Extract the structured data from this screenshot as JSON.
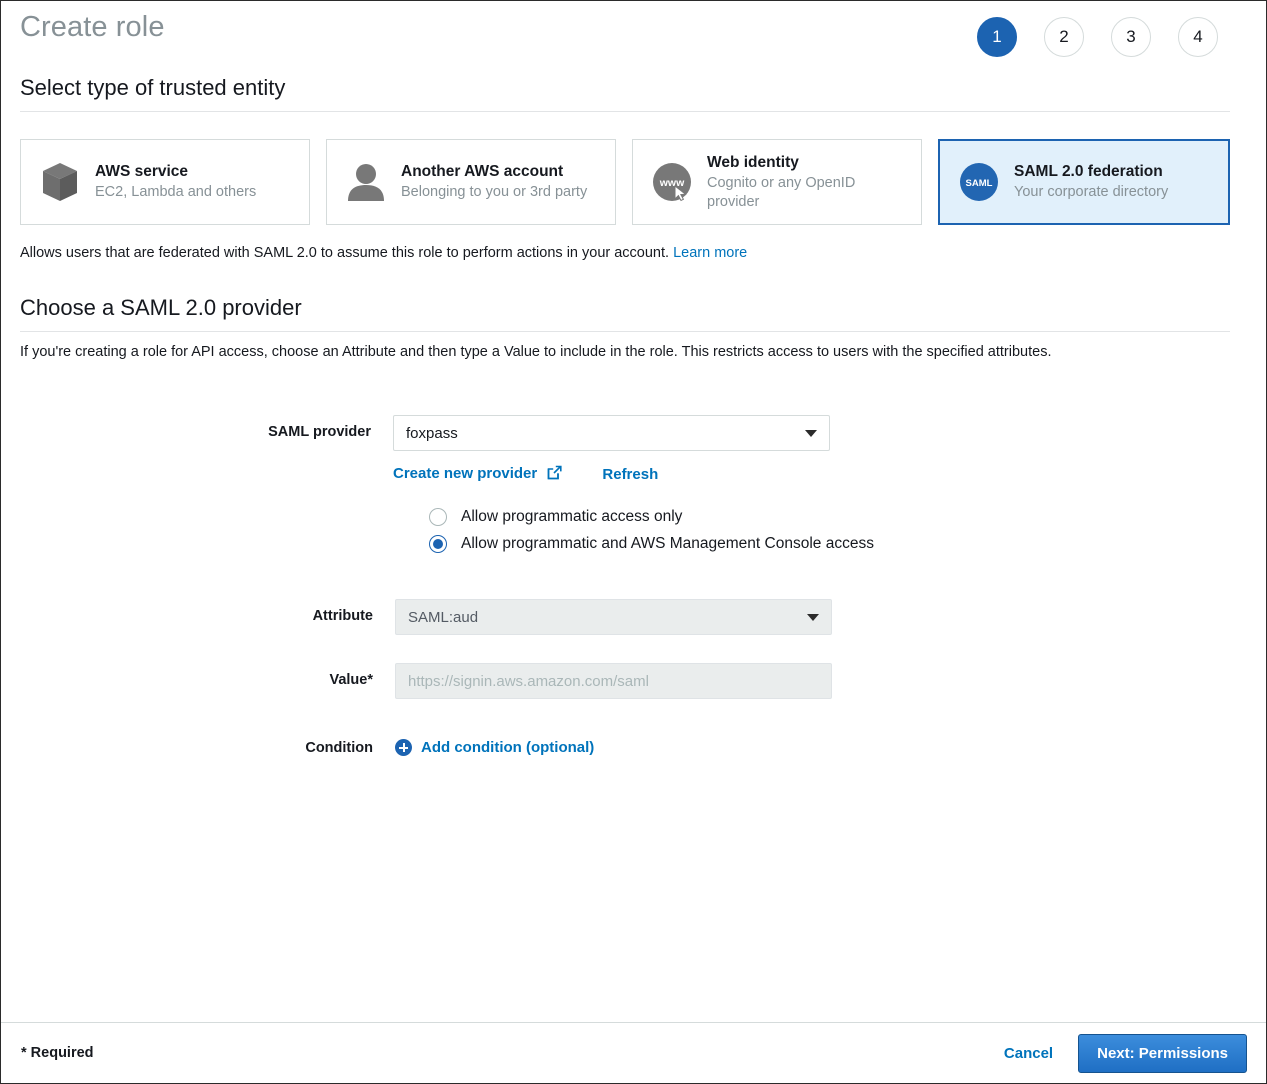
{
  "header": {
    "title": "Create role",
    "steps": [
      {
        "label": "1",
        "active": true
      },
      {
        "label": "2",
        "active": false
      },
      {
        "label": "3",
        "active": false
      },
      {
        "label": "4",
        "active": false
      }
    ]
  },
  "trusted_entity": {
    "heading": "Select type of trusted entity",
    "cards": [
      {
        "icon": "cube-icon",
        "title": "AWS service",
        "subtitle": "EC2, Lambda and others",
        "selected": false
      },
      {
        "icon": "user-icon",
        "title": "Another AWS account",
        "subtitle": "Belonging to you or 3rd party",
        "selected": false
      },
      {
        "icon": "www-icon",
        "title": "Web identity",
        "subtitle": "Cognito or any OpenID provider",
        "selected": false
      },
      {
        "icon": "saml-icon",
        "title": "SAML 2.0 federation",
        "subtitle": "Your corporate directory",
        "selected": true
      }
    ],
    "description": "Allows users that are federated with SAML 2.0 to assume this role to perform actions in your account.",
    "learn_more": "Learn more"
  },
  "provider_section": {
    "heading": "Choose a SAML 2.0 provider",
    "description": "If you're creating a role for API access, choose an Attribute and then type a Value to include in the role. This restricts access to users with the specified attributes.",
    "saml_provider": {
      "label": "SAML provider",
      "value": "foxpass",
      "create_new": "Create new provider",
      "refresh": "Refresh"
    },
    "access_options": {
      "options": [
        {
          "label": "Allow programmatic access only",
          "selected": false
        },
        {
          "label": "Allow programmatic and AWS Management Console access",
          "selected": true
        }
      ]
    },
    "attribute": {
      "label": "Attribute",
      "value": "SAML:aud",
      "disabled": true
    },
    "value_field": {
      "label": "Value*",
      "value": "",
      "placeholder": "https://signin.aws.amazon.com/saml",
      "disabled": true
    },
    "condition": {
      "label": "Condition",
      "add_label": "Add condition (optional)"
    }
  },
  "footer": {
    "required_note": "* Required",
    "cancel": "Cancel",
    "next": "Next: Permissions"
  },
  "colors": {
    "accent_blue": "#1c63b1",
    "link_blue": "#0073bb",
    "selected_card_bg": "#e1f0fb",
    "icon_grey": "#6e6e6e",
    "muted_text": "#879196"
  }
}
